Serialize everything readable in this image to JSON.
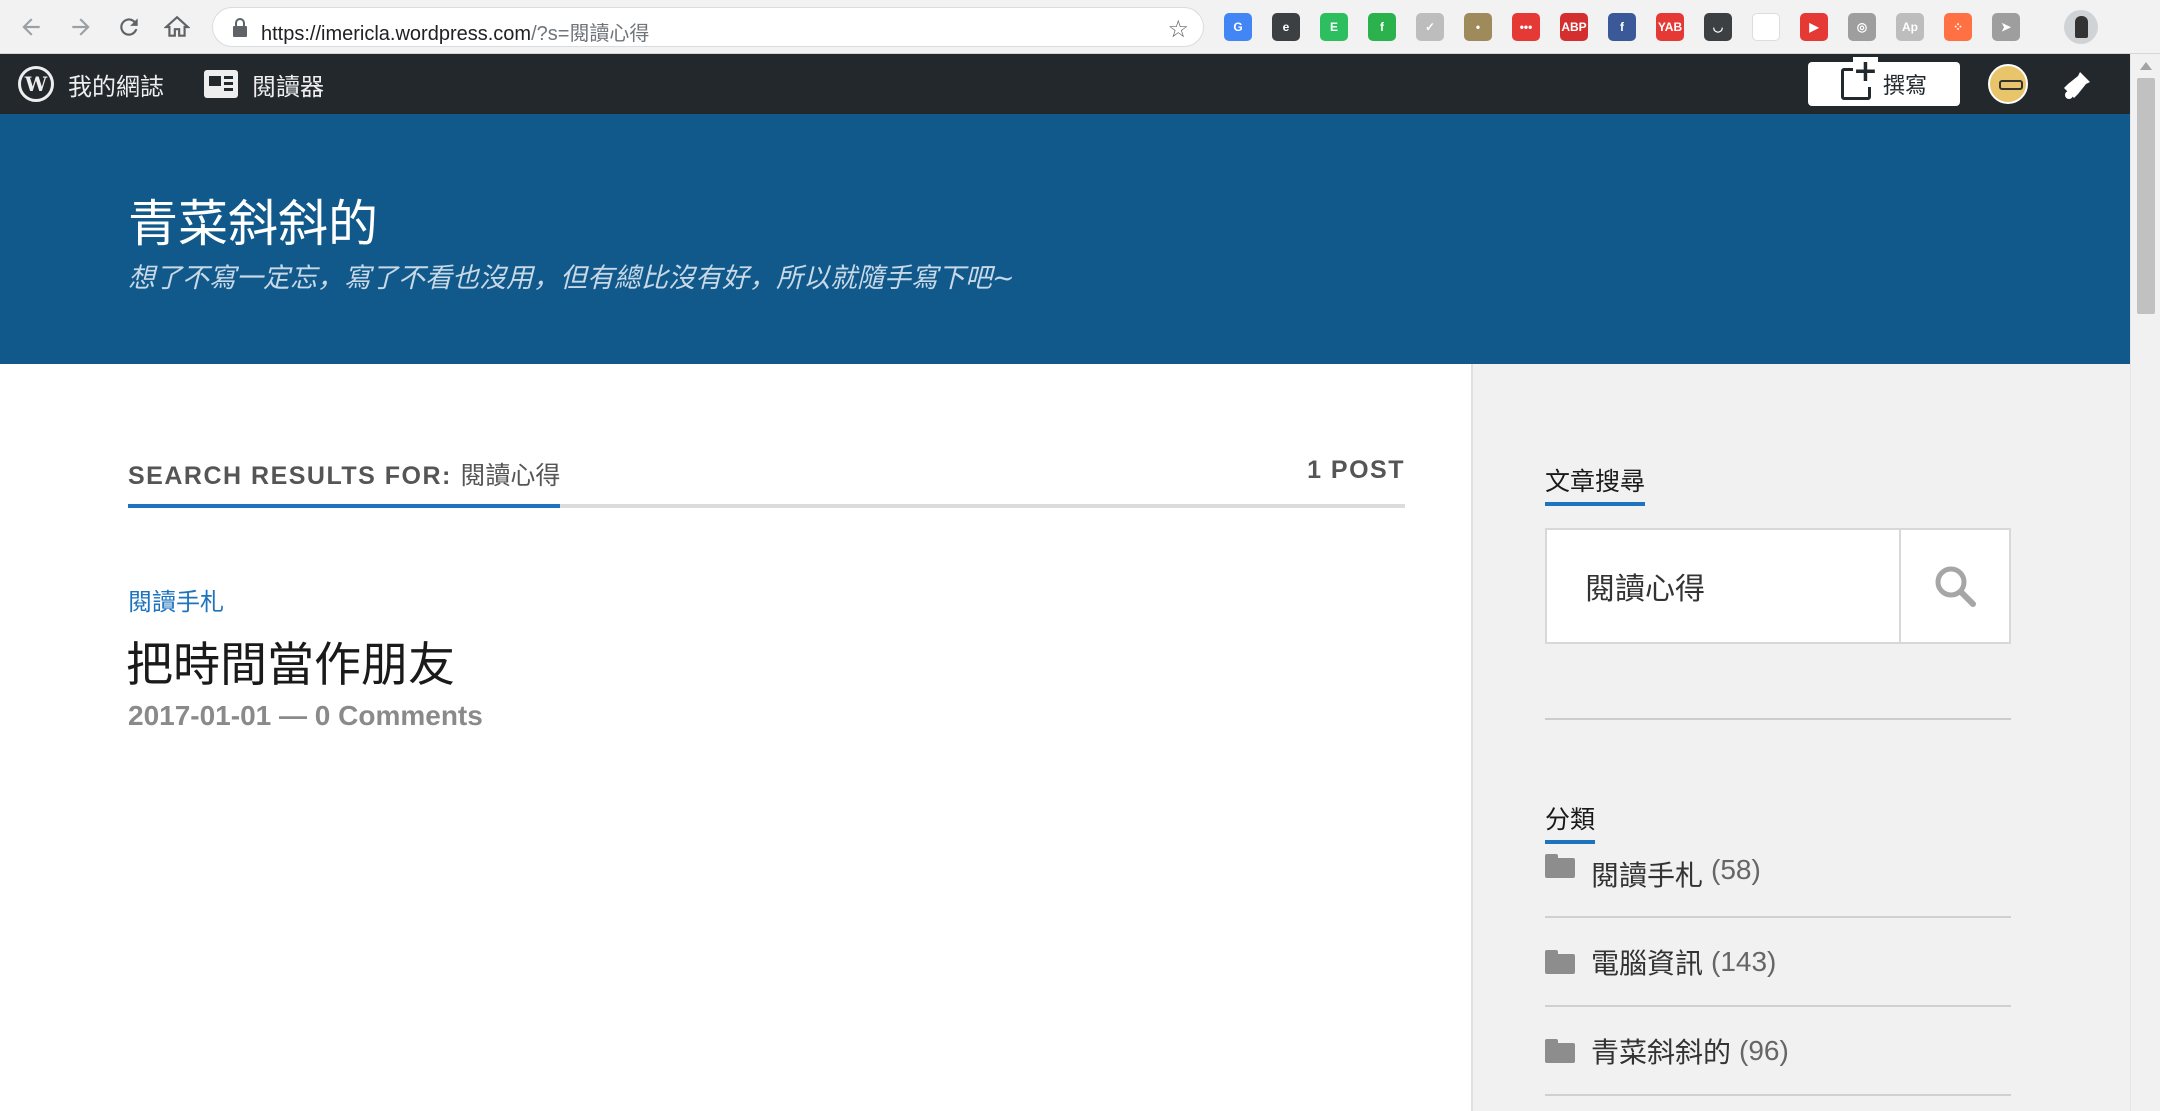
{
  "browser": {
    "url_host": "https://imericla.wordpress.com",
    "url_path": "/?s=閱讀心得",
    "extensions": [
      {
        "name": "google-translate-icon",
        "color": "#4285f4",
        "glyph": "G"
      },
      {
        "name": "e-extension-icon",
        "color": "#3c4043",
        "glyph": "e"
      },
      {
        "name": "evernote-icon",
        "color": "#2dbe60",
        "glyph": "E"
      },
      {
        "name": "feedly-icon",
        "color": "#2bb24c",
        "glyph": "f"
      },
      {
        "name": "checkmark-icon",
        "color": "#bdbdbd",
        "glyph": "✓"
      },
      {
        "name": "extension-icon",
        "color": "#9e8a5a",
        "glyph": "•"
      },
      {
        "name": "dots-extension-icon",
        "color": "#e53935",
        "glyph": "•••"
      },
      {
        "name": "adblock-plus-icon",
        "color": "#d32f2f",
        "glyph": "ABP"
      },
      {
        "name": "facebook-icon",
        "color": "#3b5998",
        "glyph": "f"
      },
      {
        "name": "yab-icon",
        "color": "#e53935",
        "glyph": "YAB"
      },
      {
        "name": "pocket-icon",
        "color": "#3c4043",
        "glyph": "◡"
      },
      {
        "name": "blank-extension-icon",
        "color": "#ffffff",
        "glyph": ""
      },
      {
        "name": "youtube-icon",
        "color": "#e53935",
        "glyph": "▶"
      },
      {
        "name": "screenshot-icon",
        "color": "#9e9e9e",
        "glyph": "◎"
      },
      {
        "name": "ap-extension-icon",
        "color": "#bdbdbd",
        "glyph": "Ap"
      },
      {
        "name": "dots-orange-icon",
        "color": "#ff7043",
        "glyph": "⁘"
      },
      {
        "name": "cursor-extension-icon",
        "color": "#9e9e9e",
        "glyph": "➤"
      }
    ]
  },
  "adminbar": {
    "my_site_label": "我的網誌",
    "reader_label": "閱讀器",
    "write_label": "撰寫"
  },
  "header": {
    "title": "青菜斜斜的",
    "description": "想了不寫一定忘，寫了不看也沒用，但有總比沒有好，所以就隨手寫下吧~"
  },
  "search_results": {
    "prefix": "SEARCH RESULTS FOR:",
    "query": "閱讀心得",
    "count": "1 POST"
  },
  "post": {
    "category": "閱讀手札",
    "title": "把時間當作朋友",
    "meta": "2017-01-01 — 0 Comments"
  },
  "sidebar": {
    "search_widget_title": "文章搜尋",
    "search_value": "閱讀心得",
    "categories_title": "分類",
    "categories": [
      {
        "name": "閱讀手札",
        "count": "(58)"
      },
      {
        "name": "電腦資訊",
        "count": "(143)"
      },
      {
        "name": "青菜斜斜的",
        "count": "(96)"
      }
    ]
  },
  "colors": {
    "header_bg": "#11598b",
    "accent": "#1e73be",
    "adminbar_bg": "#23282d"
  }
}
